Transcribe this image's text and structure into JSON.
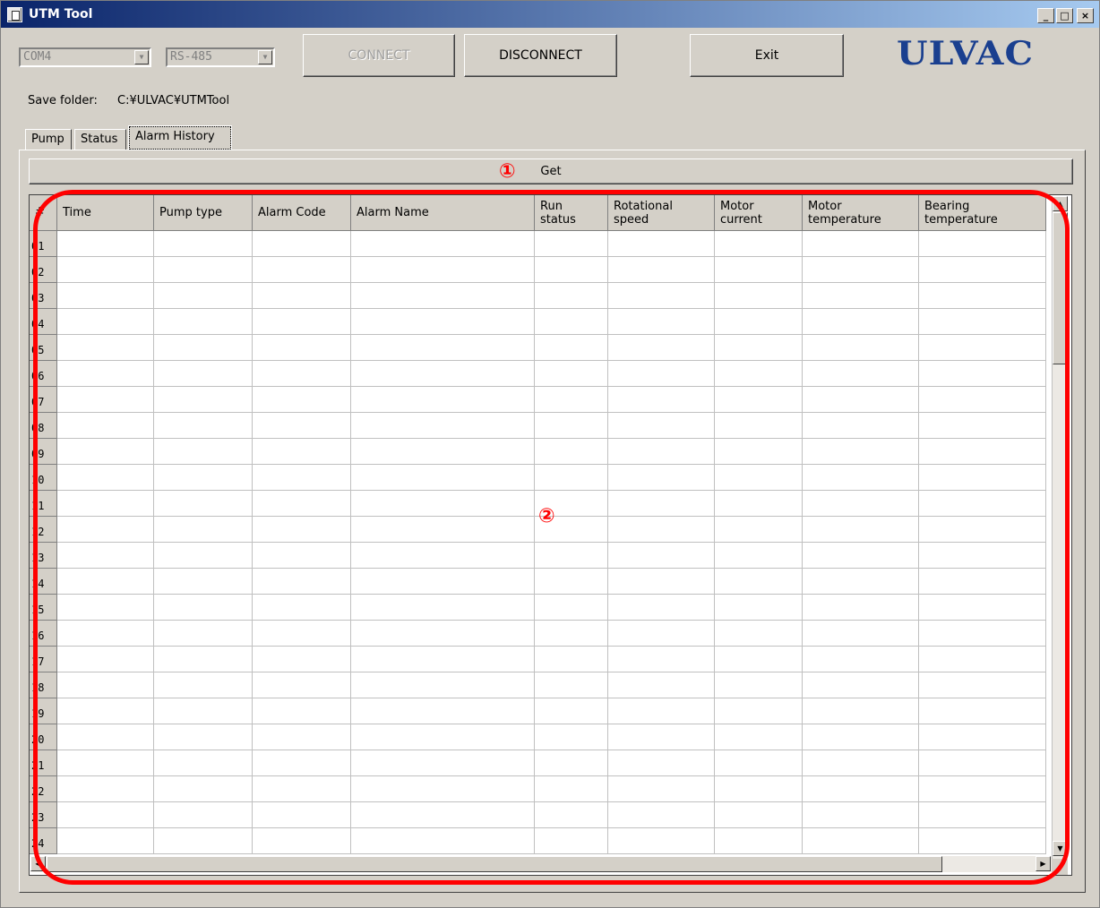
{
  "window": {
    "title": "UTM Tool",
    "min": "_",
    "max": "□",
    "close": "×"
  },
  "toolbar": {
    "port": "COM4",
    "protocol": "RS-485",
    "connect_label": "CONNECT",
    "disconnect_label": "DISCONNECT",
    "exit_label": "Exit",
    "logo": "ULVAC"
  },
  "save": {
    "label": "Save folder:",
    "path": "C:¥ULVAC¥UTMTool"
  },
  "tabs": [
    "Pump",
    "Status",
    "Alarm History"
  ],
  "active_tab": "Alarm History",
  "get_label": "Get",
  "table": {
    "columns": [
      {
        "label": "#"
      },
      {
        "label": "Time"
      },
      {
        "label": "Pump type"
      },
      {
        "label": "Alarm Code"
      },
      {
        "label": "Alarm Name"
      },
      {
        "label": "Run\nstatus"
      },
      {
        "label": "Rotational\nspeed"
      },
      {
        "label": "Motor\ncurrent"
      },
      {
        "label": "Motor\ntemperature"
      },
      {
        "label": "Bearing\ntemperature"
      }
    ],
    "row_labels": [
      "01",
      "02",
      "03",
      "04",
      "05",
      "06",
      "07",
      "08",
      "09",
      "10",
      "11",
      "12",
      "13",
      "14",
      "15",
      "16",
      "17",
      "18",
      "19",
      "20",
      "21",
      "22",
      "23",
      "24"
    ]
  },
  "annotations": {
    "one": "①",
    "two": "②"
  },
  "colors": {
    "annotation": "#ff0000",
    "logo": "#1a3f8f",
    "titlebar_start": "#0a246a",
    "titlebar_end": "#a6caf0"
  }
}
